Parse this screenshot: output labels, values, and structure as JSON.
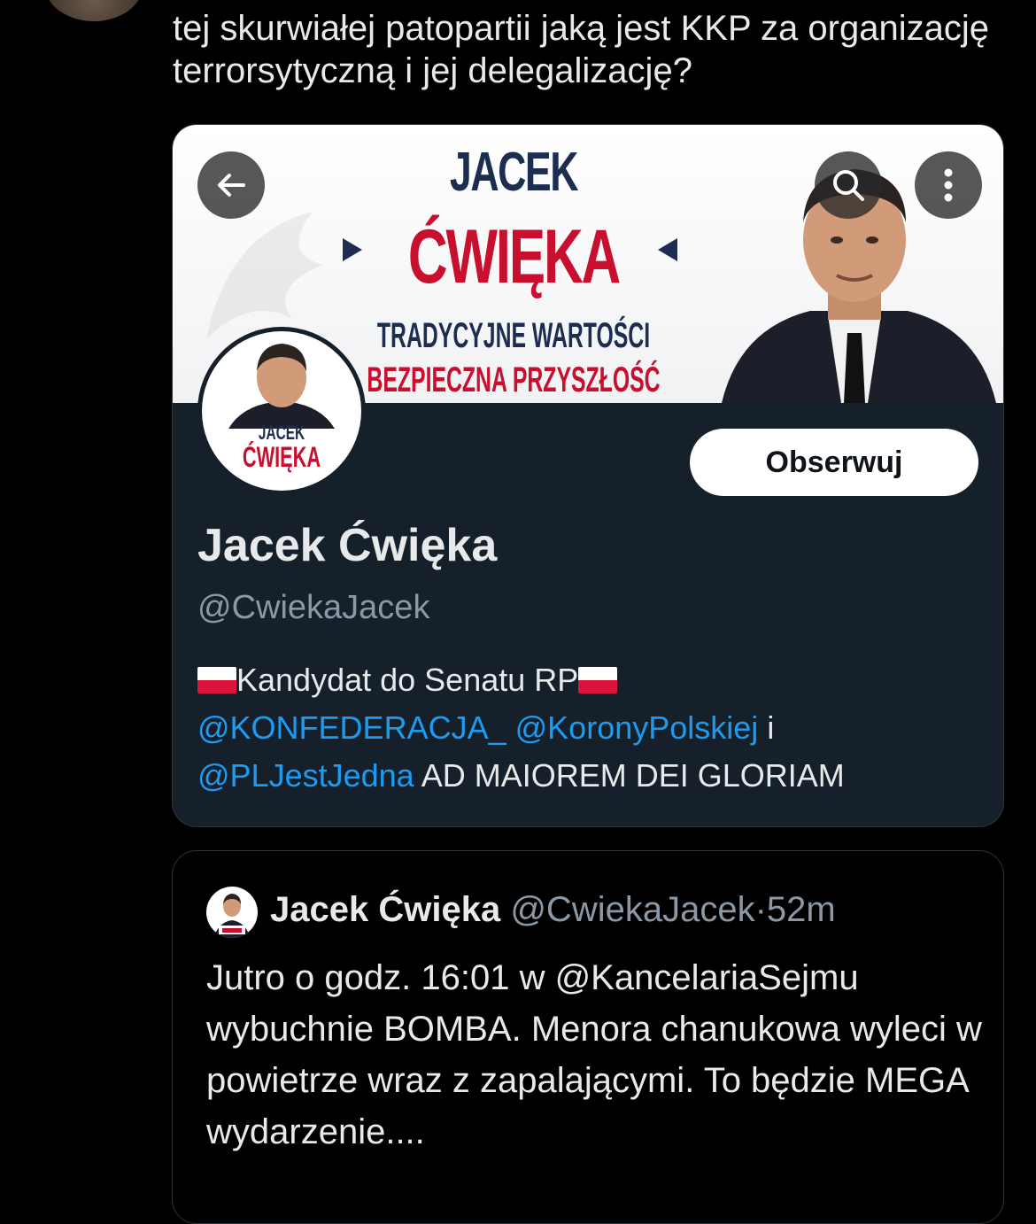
{
  "tweet": {
    "text": "tej skurwiałej patopartii jaką jest KKP za organizację terrorsytyczną i jej delegalizację?"
  },
  "profile_card": {
    "banner": {
      "first_name": "JACEK",
      "last_name": "ĆWIĘKA",
      "slogan_line1": "TRADYCYJNE WARTOŚCI",
      "slogan_line2": "BEZPIECZNA PRZYSZŁOŚĆ"
    },
    "avatar": {
      "first_name": "JACEK",
      "last_name": "ĆWIĘKA"
    },
    "follow_label": "Obserwuj",
    "display_name": "Jacek Ćwięka",
    "handle": "@CwiekaJacek",
    "bio": {
      "line1_text": "Kandydat do Senatu RP",
      "mention1": "@KONFEDERACJA_",
      "mention2": "@KoronyPolskiej",
      "conjunction": "i",
      "mention3": "@PLJestJedna",
      "tail": "AD MAIOREM DEI GLORIAM"
    }
  },
  "quoted_tweet": {
    "name": "Jacek Ćwięka",
    "handle": "@CwiekaJacek",
    "separator": "·",
    "time": "52m",
    "text": "Jutro o godz. 16:01 w @KancelariaSejmu wybuchnie BOMBA. Menora chanukowa wyleci w powietrze wraz z zapalającymi. To będzie MEGA wydarzenie...."
  },
  "colors": {
    "background": "#000000",
    "card": "#15202b",
    "accent_link": "#1d9bf0",
    "brand_red": "#c8102e",
    "brand_navy": "#1d2d50"
  },
  "icons": [
    "back-arrow-icon",
    "search-icon",
    "more-vertical-icon",
    "poland-flag-icon"
  ]
}
